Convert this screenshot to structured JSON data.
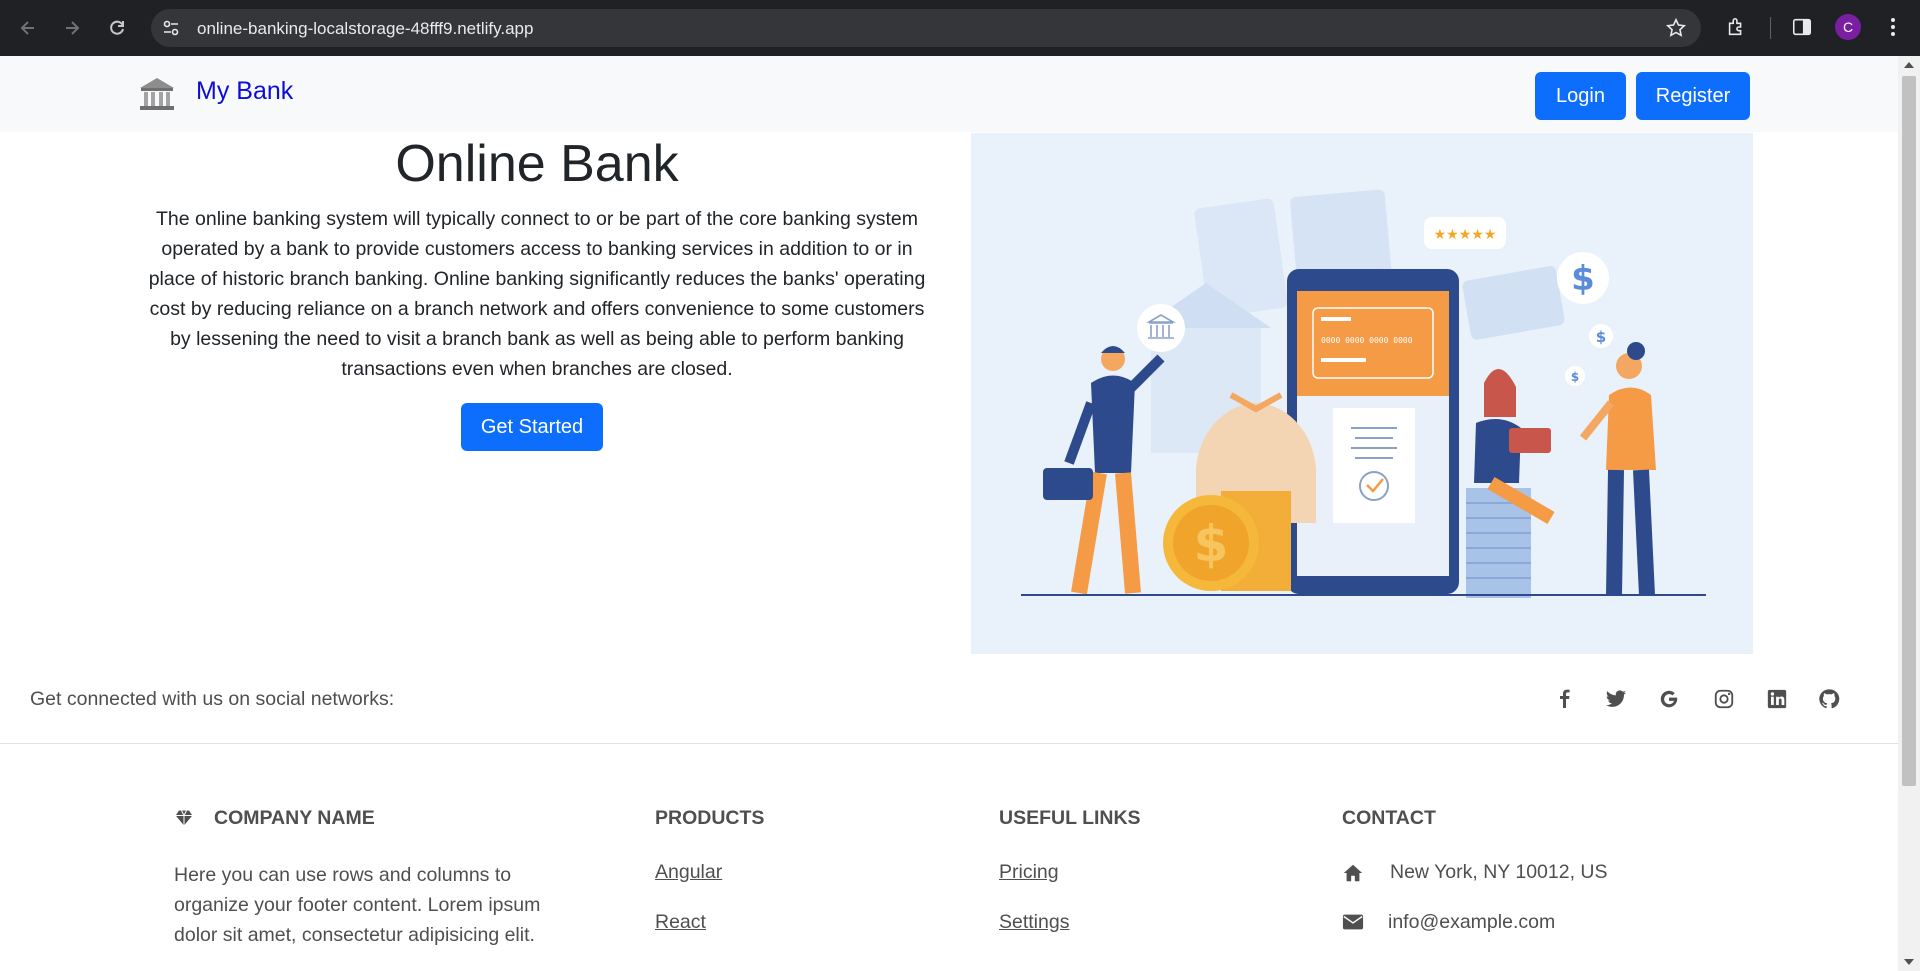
{
  "browser": {
    "url": "online-banking-localstorage-48fff9.netlify.app",
    "profile_initial": "C",
    "icons": [
      "back-icon",
      "forward-icon",
      "reload-icon",
      "site-info-icon",
      "bookmark-star-icon",
      "extensions-icon",
      "sidepanel-icon",
      "menu-kebab-icon"
    ]
  },
  "navbar": {
    "brand": "My Bank",
    "brand_icon": "bank-building-icon",
    "login_label": "Login",
    "register_label": "Register"
  },
  "hero": {
    "title": "Online Bank",
    "description": "The online banking system will typically connect to or be part of the core banking system operated by a bank to provide customers access to banking services in addition to or in place of historic branch banking. Online banking significantly reduces the banks' operating cost by reducing reliance on a branch network and offers convenience to some customers by lessening the need to visit a branch bank as well as being able to perform banking transactions even when branches are closed.",
    "cta_label": "Get Started",
    "image_content": {
      "card_number": "0000 0000 0000 0000",
      "rating_stars": 5,
      "currency_symbol": "$"
    }
  },
  "social": {
    "text": "Get connected with us on social networks:",
    "icons": [
      "facebook-icon",
      "twitter-icon",
      "google-icon",
      "instagram-icon",
      "linkedin-icon",
      "github-icon"
    ]
  },
  "footer": {
    "company": {
      "heading": "COMPANY NAME",
      "icon": "gem-icon",
      "text": "Here you can use rows and columns to organize your footer content. Lorem ipsum dolor sit amet, consectetur adipisicing elit."
    },
    "products": {
      "heading": "PRODUCTS",
      "links": [
        "Angular",
        "React"
      ]
    },
    "useful_links": {
      "heading": "USEFUL LINKS",
      "links": [
        "Pricing",
        "Settings"
      ]
    },
    "contact": {
      "heading": "CONTACT",
      "address": "New York, NY 10012, US",
      "email": "info@example.com"
    }
  },
  "colors": {
    "primary": "#0d6efd",
    "brand_text": "#0d0dd6",
    "navbar_bg": "#f8f9fa",
    "hero_image_bg": "#e9f1fb",
    "chrome_bg": "#202124"
  }
}
